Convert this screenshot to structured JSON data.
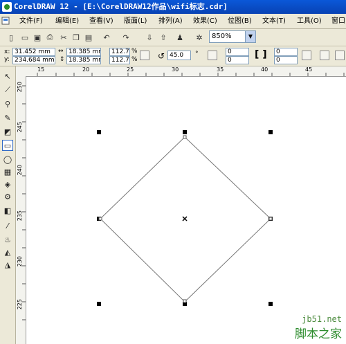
{
  "window": {
    "title": "CorelDRAW 12 - [E:\\CorelDRAW12作品\\wifi标志.cdr]"
  },
  "menu": [
    "文件(F)",
    "编辑(E)",
    "查看(V)",
    "版面(L)",
    "排列(A)",
    "效果(C)",
    "位图(B)",
    "文本(T)",
    "工具(O)",
    "窗口"
  ],
  "toolbar": {
    "zoom": "850%"
  },
  "property_bar": {
    "x": "31.452 mm",
    "y": "234.684 mm",
    "width": "18.385 mm",
    "height": "18.385 mm",
    "scale_x": "112.7",
    "scale_y": "112.7",
    "percent": "%",
    "angle": "45.0",
    "degree": "°",
    "corner_values": [
      "0",
      "0",
      "0",
      "0"
    ]
  },
  "rulers": {
    "horizontal": [
      "15",
      "20",
      "25",
      "30",
      "35",
      "40",
      "45"
    ],
    "vertical": [
      "250",
      "245",
      "240",
      "235",
      "230",
      "225"
    ]
  },
  "watermark": {
    "site": "jb51.net",
    "name": "脚本之家"
  },
  "icons": {
    "tools": [
      "pick-tool-icon",
      "shape-tool-icon",
      "zoom-tool-icon",
      "freehand-tool-icon",
      "smart-fill-icon",
      "rectangle-tool-icon",
      "ellipse-tool-icon",
      "graph-paper-icon",
      "basic-shapes-icon",
      "text-tool-icon",
      "interactive-blend-icon",
      "eyedropper-icon",
      "outline-pen-icon",
      "fill-tool-icon",
      "interactive-fill-icon"
    ]
  }
}
